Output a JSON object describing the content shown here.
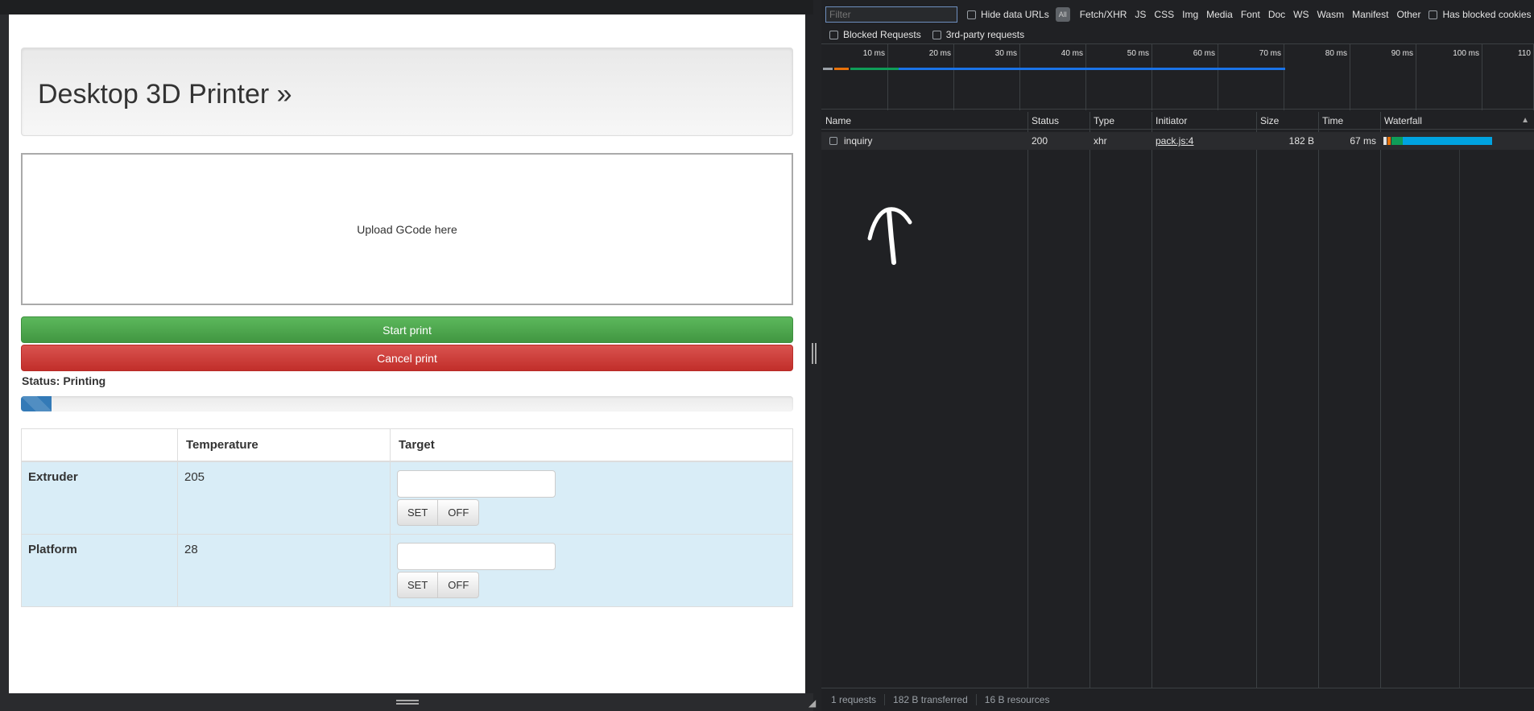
{
  "app": {
    "title": "Desktop 3D Printer »",
    "dropzone_text": "Upload GCode here",
    "start_label": "Start print",
    "cancel_label": "Cancel print",
    "status_label": "Status: Printing",
    "progress_fraction": 0.04,
    "table": {
      "headers": [
        "",
        "Temperature",
        "Target"
      ],
      "rows": [
        {
          "label": "Extruder",
          "temperature": "205",
          "target_value": "",
          "set_label": "SET",
          "off_label": "OFF"
        },
        {
          "label": "Platform",
          "temperature": "28",
          "target_value": "",
          "set_label": "SET",
          "off_label": "OFF"
        }
      ]
    }
  },
  "devtools": {
    "filter_placeholder": "Filter",
    "hide_data_urls": "Hide data URLs",
    "aa_label": "All",
    "type_filters": [
      "Fetch/XHR",
      "JS",
      "CSS",
      "Img",
      "Media",
      "Font",
      "Doc",
      "WS",
      "Wasm",
      "Manifest",
      "Other"
    ],
    "has_blocked_cookies": "Has blocked cookies",
    "blocked_requests": "Blocked Requests",
    "third_party": "3rd-party requests",
    "overview_ticks": [
      "10 ms",
      "20 ms",
      "30 ms",
      "40 ms",
      "50 ms",
      "60 ms",
      "70 ms",
      "80 ms",
      "90 ms",
      "100 ms",
      "110"
    ],
    "columns": {
      "name": "Name",
      "status": "Status",
      "type": "Type",
      "initiator": "Initiator",
      "size": "Size",
      "time": "Time",
      "waterfall": "Waterfall"
    },
    "requests": [
      {
        "name": "inquiry",
        "status": "200",
        "type": "xhr",
        "initiator": "pack.js:4",
        "size": "182 B",
        "time": "67 ms"
      }
    ],
    "summary": {
      "requests": "1 requests",
      "transferred": "182 B transferred",
      "resources": "16 B resources"
    },
    "colors": {
      "waiting": "#00a3e0",
      "content": "#0f9d58",
      "queue": "#e8710a"
    }
  }
}
